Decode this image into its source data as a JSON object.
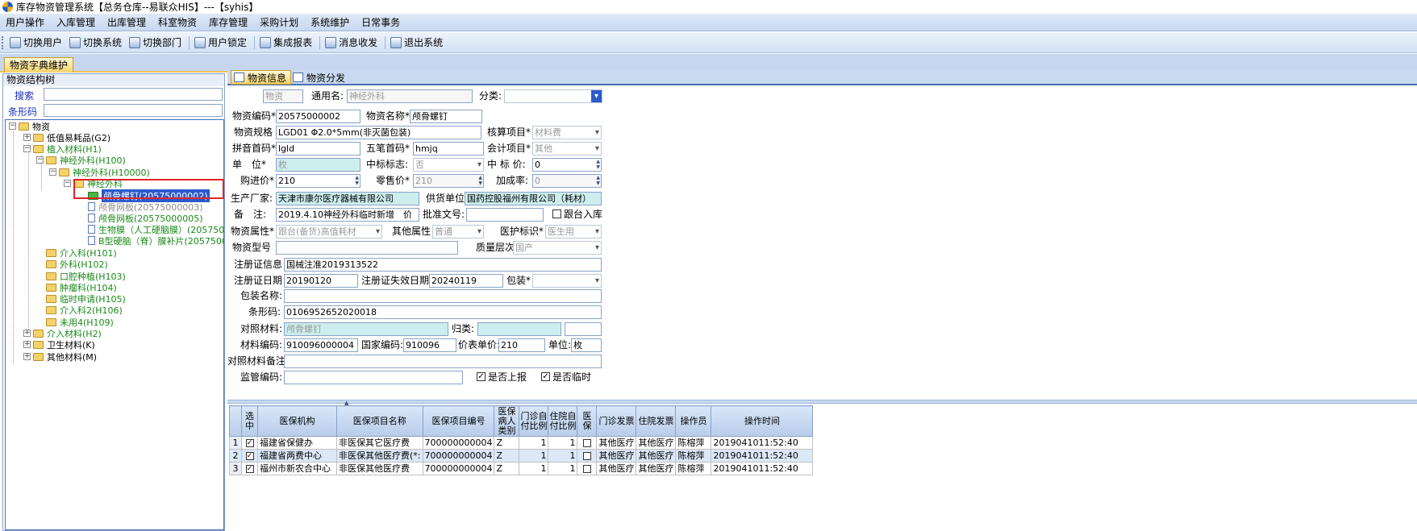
{
  "window": {
    "title": "库存物资管理系统【总务仓库--易联众HIS】---【syhis】"
  },
  "menu": [
    "用户操作",
    "入库管理",
    "出库管理",
    "科室物资",
    "库存管理",
    "采购计划",
    "系统维护",
    "日常事务"
  ],
  "toolbar": [
    "切换用户",
    "切换系统",
    "切换部门",
    "用户锁定",
    "集成报表",
    "消息收发",
    "退出系统"
  ],
  "doc_tab": "物资字典维护",
  "left": {
    "title": "物资结构树",
    "search_label": "搜索",
    "barcode_label": "条形码",
    "tree": [
      "物资",
      "低值易耗品(G2)",
      "植入材料(H1)",
      "神经外科(H100)",
      "神经外科(H10000)",
      "神经外科",
      "颅骨螺钉(20575000002)",
      "颅骨网板(20575000003)",
      "颅骨网板(20575000005)",
      "生物膜（人工硬脑膜）(20575000",
      "B型硬脑（脊）膜补片(2057500",
      "介入科(H101)",
      "外科(H102)",
      "口腔种植(H103)",
      "肿瘤科(H104)",
      "临时申请(H105)",
      "介入科2(H106)",
      "未用4(H109)",
      "介入材料(H2)",
      "卫生材料(K)",
      "其他材料(M)"
    ]
  },
  "tabs": {
    "info": "物资信息",
    "dist": "物资分发"
  },
  "form": {
    "l_wuzi": "物资",
    "l_tongyong": "通用名:",
    "v_tongyong": "神经外科",
    "l_fenlei": "分类:",
    "v_fenlei": "",
    "l_code": "物资编码*",
    "v_code": "20575000002",
    "l_name": "物资名称*",
    "v_name": "颅骨螺钉",
    "l_spec": "物资规格",
    "v_spec": "LGD01 Φ2.0*5mm(非灭菌包装)",
    "l_hesuan": "核算项目*",
    "v_hesuan": "材料费",
    "l_pinyin": "拼音首码*",
    "v_pinyin": "lgld",
    "l_wubi": "五笔首码*",
    "v_wubi": "hmjq",
    "l_kuaiji": "会计项目*",
    "v_kuaiji": "其他",
    "l_unit": "单　位*",
    "v_unit": "枚",
    "l_zhongbiao": "中标标志:",
    "v_zhongbiao": "否",
    "l_zbprice": "中 标 价:",
    "v_zbprice": "0",
    "l_buy": "购进价*",
    "v_buy": "210",
    "l_sale": "零售价*",
    "v_sale": "210",
    "l_jiacheng": "加成率:",
    "v_jiacheng": "0",
    "l_maker": "生产厂家:",
    "v_maker": "天津市康尔医疗器械有限公司",
    "l_supplier": "供货单位",
    "v_supplier": "国药控股福州有限公司（耗材）",
    "l_note": "备　注:",
    "v_note": "2019.4.10神经外科临时新增　价",
    "l_pizhun": "批准文号:",
    "v_pizhun": "",
    "l_genjin": "跟台入库",
    "l_shuxing": "物资属性*",
    "v_shuxing": "跟台(备货)高值耗材",
    "l_other": "其他属性",
    "v_other": "普通",
    "l_yihu": "医护标识*",
    "v_yihu": "医生用",
    "l_model": "物资型号",
    "v_model": "",
    "l_quality": "质量层次:",
    "v_quality": "国产",
    "l_reg": "注册证信息",
    "v_reg": "国械注准2019313522",
    "l_regdate": "注册证日期",
    "v_regdate": "20190120",
    "l_regexp": "注册证失效日期",
    "v_regexp": "20240119",
    "l_pack": "包装*",
    "v_pack": "",
    "l_packname": "包装名称:",
    "v_packname": "",
    "l_barcode": "条形码:",
    "v_barcode": "0106952652020018",
    "l_duizhao": "对照材料:",
    "v_duizhao": "颅骨螺钉",
    "l_guilei": "归类:",
    "v_guilei": "",
    "l_matcode": "材料编码:",
    "v_matcode": "910096000004",
    "l_natcode": "国家编码:",
    "v_natcode": "910096",
    "l_price_unit": "价表单价:",
    "v_price_unit": "210",
    "l_danwei": "单位:",
    "v_danwei": "枚",
    "l_duizhao_note": "对照材料备注",
    "l_jianguan": "监管编码:",
    "v_jianguan": "",
    "l_shangbao": "是否上报",
    "l_linshi": "是否临时"
  },
  "grid": {
    "headers": [
      "选中",
      "医保机构",
      "医保项目名称",
      "医保项目编号",
      "医保病人类别",
      "门诊自付比例",
      "住院自付比例",
      "医保",
      "门诊发票",
      "住院发票",
      "操作员",
      "操作时间"
    ],
    "rows": [
      [
        "1",
        "福建省保健办",
        "非医保其它医疗费",
        "700000000004",
        "Z",
        "1",
        "1",
        "其他医疗",
        "其他医疗",
        "陈榕萍",
        "2019041011:52:40"
      ],
      [
        "2",
        "福建省两费中心",
        "非医保其他医疗费(*:",
        "700000000004",
        "Z",
        "1",
        "1",
        "其他医疗",
        "其他医疗",
        "陈榕萍",
        "2019041011:52:40"
      ],
      [
        "3",
        "福州市新农合中心",
        "非医保其他医疗费",
        "700000000004",
        "Z",
        "1",
        "1",
        "其他医疗",
        "其他医疗",
        "陈榕萍",
        "2019041011:52:40"
      ]
    ]
  },
  "colors": {
    "accent": "#2a5bcc",
    "highlight": "#e0242a",
    "tab": "#f7d36a"
  }
}
